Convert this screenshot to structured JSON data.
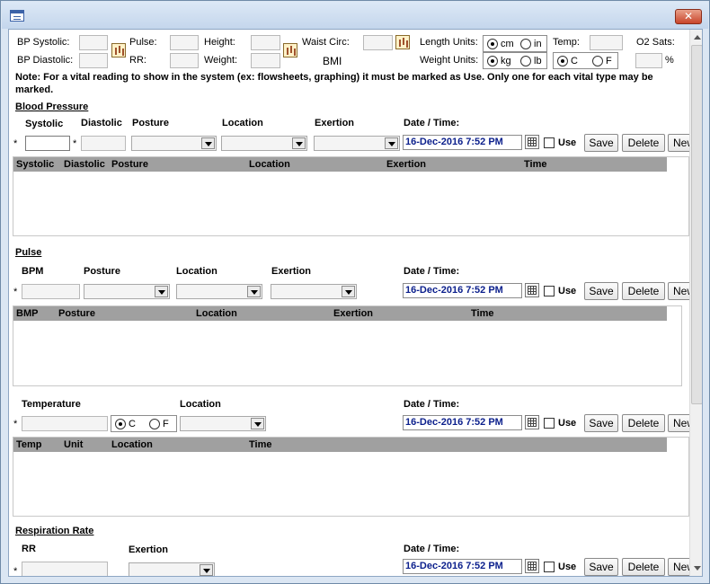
{
  "header": {
    "bp_systolic": "BP Systolic:",
    "bp_diastolic": "BP Diastolic:",
    "pulse": "Pulse:",
    "rr": "RR:",
    "height": "Height:",
    "weight": "Weight:",
    "waist_circ": "Waist Circ:",
    "bmi": "BMI",
    "length_units": "Length Units:",
    "weight_units": "Weight Units:",
    "temp": "Temp:",
    "o2_sats": "O2 Sats:",
    "percent": "%",
    "cm": "cm",
    "in": "in",
    "kg": "kg",
    "lb": "lb",
    "c": "C",
    "f": "F"
  },
  "note": "Note: For a vital reading to show in the system (ex: flowsheets, graphing) it must be marked as Use. Only one for each vital type may be marked.",
  "common": {
    "date_time": "Date / Time:",
    "date_value": "16-Dec-2016 7:52 PM",
    "use": "Use",
    "save": "Save",
    "delete": "Delete",
    "new": "New",
    "asterisk": "*"
  },
  "blood_pressure": {
    "title": "Blood Pressure",
    "systolic": "Systolic",
    "diastolic": "Diastolic",
    "posture": "Posture",
    "location": "Location",
    "exertion": "Exertion",
    "columns": [
      "Systolic",
      "Diastolic",
      "Posture",
      "Location",
      "Exertion",
      "Time"
    ]
  },
  "pulse": {
    "title": "Pulse",
    "bpm": "BPM",
    "posture": "Posture",
    "location": "Location",
    "exertion": "Exertion",
    "columns": [
      "BMP",
      "Posture",
      "Location",
      "Exertion",
      "Time"
    ]
  },
  "temperature": {
    "title": "Temperature",
    "location": "Location",
    "c": "C",
    "f": "F",
    "columns": [
      "Temp",
      "Unit",
      "Location",
      "Time"
    ]
  },
  "respiration": {
    "title": "Respiration Rate",
    "rr": "RR",
    "exertion": "Exertion"
  }
}
